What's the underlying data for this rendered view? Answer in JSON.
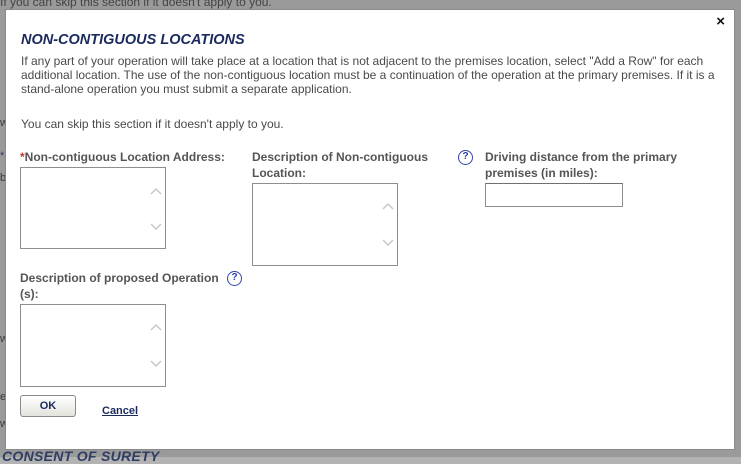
{
  "background": {
    "top_text": "If you can skip this section if it doesn't apply to you.",
    "bottom_heading": "CONSENT OF SURETY"
  },
  "modal": {
    "close_glyph": "×",
    "title": "NON-CONTIGUOUS LOCATIONS",
    "intro": "If any part of your operation will take place at a location that is not adjacent to the premises location, select \"Add a Row\" for each additional location. The use of the non-contiguous location must be a continuation of the operation at the primary premises. If it is a stand-alone operation you must submit a separate application.",
    "skip_note": "You can skip this section if it doesn't apply to you.",
    "fields": {
      "address": {
        "required_mark": "*",
        "label": "Non-contiguous Location Address:",
        "value": ""
      },
      "description": {
        "label": "Description of Non-contiguous Location:",
        "value": ""
      },
      "distance": {
        "label": "Driving distance from the primary premises (in miles):",
        "value": ""
      },
      "operation": {
        "label": "Description of proposed Operation (s):",
        "value": ""
      }
    },
    "help_glyph": "?",
    "ok_label": "OK",
    "cancel_label": "Cancel"
  }
}
